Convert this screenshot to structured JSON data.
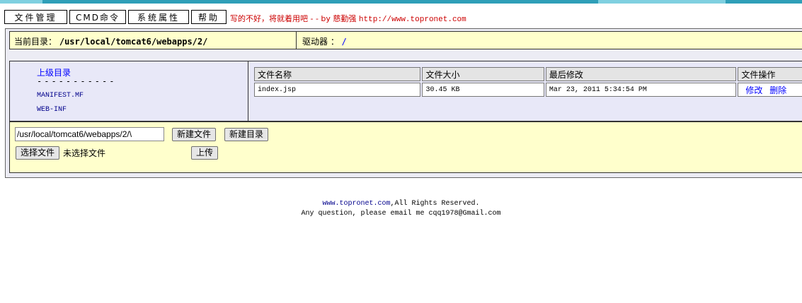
{
  "menu": {
    "items": [
      "文件管理",
      "CMD命令",
      "系统属性",
      "帮助"
    ],
    "slogan": "写的不好，将就着用吧 - - by 慈勤强",
    "slogan_url": "http://www.topronet.com"
  },
  "pathbar": {
    "label": "当前目录：",
    "path": "/usr/local/tomcat6/webapps/2/",
    "drive_label": "驱动器 ：",
    "drive_value": "/"
  },
  "dirpane": {
    "parent_link": "上级目录",
    "divider": "-----------",
    "entries": [
      "MANIFEST.MF",
      "WEB-INF"
    ]
  },
  "files": {
    "headers": [
      "文件名称",
      "文件大小",
      "最后修改",
      "文件操作"
    ],
    "rows": [
      {
        "name": "index.jsp",
        "size": "30.45 KB",
        "modified": "Mar 23, 2011 5:34:54 PM",
        "op_edit": "修改",
        "op_delete": "删除"
      }
    ]
  },
  "upload": {
    "path_value": "/usr/local/tomcat6/webapps/2/\\",
    "new_file": "新建文件",
    "new_dir": "新建目录",
    "choose_file": "选择文件",
    "no_file": "未选择文件",
    "upload": "上传"
  },
  "footer": {
    "site": "www.topronet.com",
    "rights": ",All Rights Reserved.",
    "contact": "Any question, please email me cqq1978@Gmail.com"
  },
  "colors": {
    "accent_bar": "#2f9fb8",
    "slogan": "#cc0000",
    "link": "#0000ff",
    "panel_yellow": "#ffffcc",
    "panel_lavender": "#e8e8f8"
  }
}
